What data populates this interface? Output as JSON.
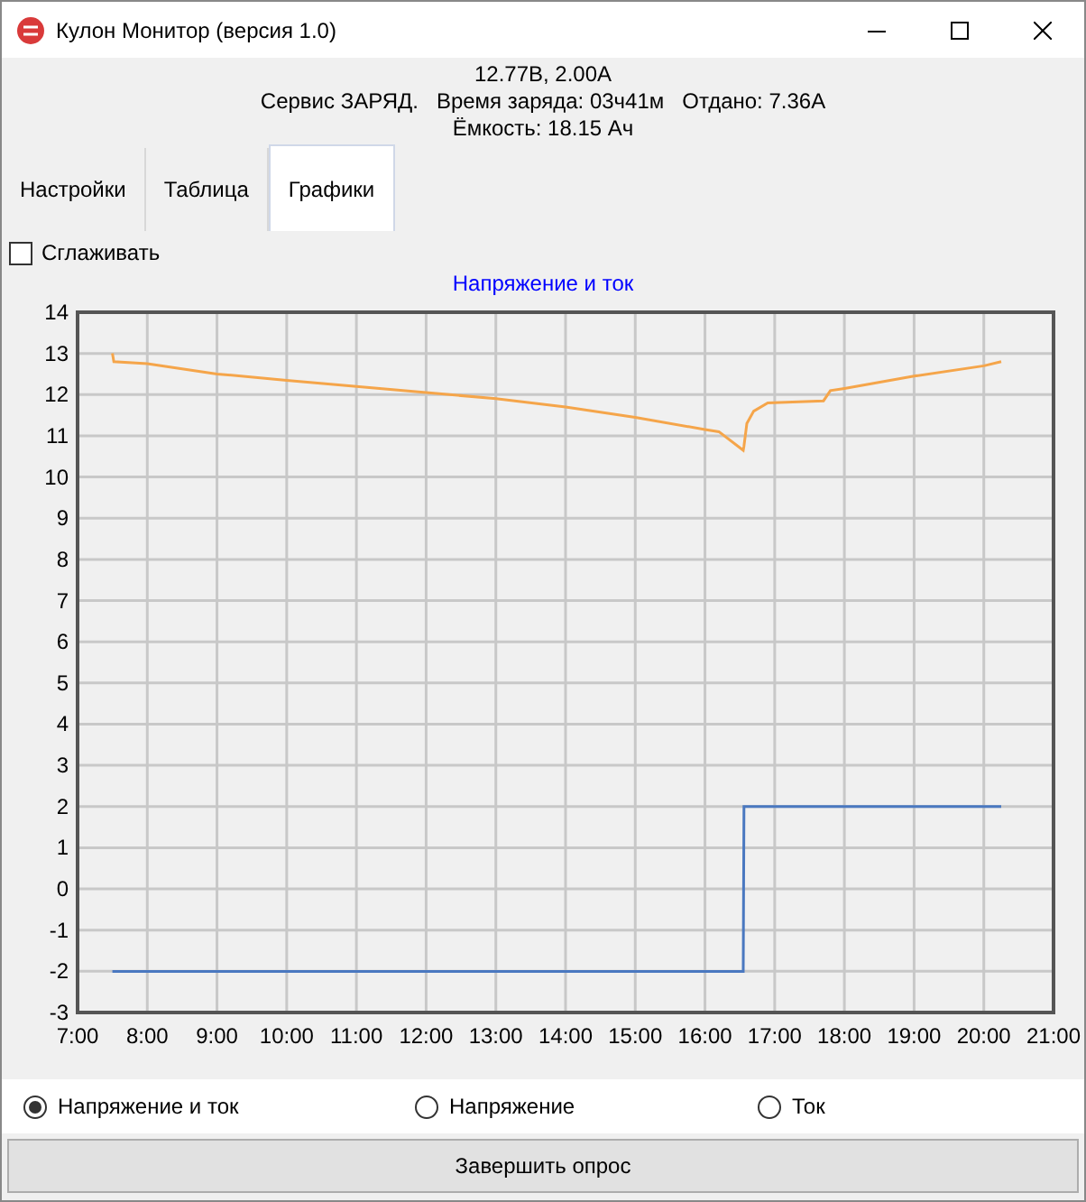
{
  "window": {
    "title": "Кулон Монитор (версия 1.0)"
  },
  "status": {
    "lines": [
      [
        "12.77В, 2.00А"
      ],
      [
        "Сервис ЗАРЯД.",
        "Время заряда: 03ч41м",
        "Отдано: 7.36А"
      ],
      [
        "Ёмкость: 18.15 Ач"
      ]
    ]
  },
  "tabs": [
    {
      "label": "Настройки",
      "selected": false
    },
    {
      "label": "Таблица",
      "selected": false
    },
    {
      "label": "Графики",
      "selected": true
    }
  ],
  "smoothing": {
    "label": "Сглаживать",
    "checked": false
  },
  "chart": {
    "chart_data": {
      "type": "line",
      "title": "Напряжение и ток",
      "x": [
        7.5,
        7.52,
        8,
        9,
        10,
        11,
        12,
        13,
        14,
        15,
        16,
        16.2,
        16.55,
        16.56,
        16.6,
        16.7,
        16.9,
        17.7,
        17.8,
        18,
        19,
        20,
        20.25
      ],
      "series": [
        {
          "color": "#f5a54a",
          "values": [
            13.0,
            12.8,
            12.75,
            12.5,
            12.35,
            12.2,
            12.05,
            11.9,
            11.7,
            11.45,
            11.15,
            11.1,
            10.65,
            10.75,
            11.3,
            11.6,
            11.8,
            11.85,
            12.1,
            12.15,
            12.45,
            12.7,
            12.8
          ]
        },
        {
          "color": "#4a78c0",
          "values": [
            -2,
            -2,
            -2,
            -2,
            -2,
            -2,
            -2,
            -2,
            -2,
            -2,
            -2,
            -2,
            -2,
            2,
            2,
            2,
            2,
            2,
            2,
            2,
            2,
            2,
            2
          ]
        }
      ],
      "grid": true,
      "xlim": [
        7,
        21
      ],
      "ylim": [
        -3,
        14
      ],
      "xticks": [
        {
          "value": 7,
          "label": "7:00"
        },
        {
          "value": 8,
          "label": "8:00"
        },
        {
          "value": 9,
          "label": "9:00"
        },
        {
          "value": 10,
          "label": "10:00"
        },
        {
          "value": 11,
          "label": "11:00"
        },
        {
          "value": 12,
          "label": "12:00"
        },
        {
          "value": 13,
          "label": "13:00"
        },
        {
          "value": 14,
          "label": "14:00"
        },
        {
          "value": 15,
          "label": "15:00"
        },
        {
          "value": 16,
          "label": "16:00"
        },
        {
          "value": 17,
          "label": "17:00"
        },
        {
          "value": 18,
          "label": "18:00"
        },
        {
          "value": 19,
          "label": "19:00"
        },
        {
          "value": 20,
          "label": "20:00"
        },
        {
          "value": 21,
          "label": "21:00"
        }
      ],
      "yticks": [
        -3,
        -2,
        -1,
        0,
        1,
        2,
        3,
        4,
        5,
        6,
        7,
        8,
        9,
        10,
        11,
        12,
        13,
        14
      ]
    }
  },
  "modes": [
    {
      "label": "Напряжение и ток",
      "selected": true
    },
    {
      "label": "Напряжение",
      "selected": false
    },
    {
      "label": "Ток",
      "selected": false
    }
  ],
  "button": {
    "label": "Завершить опрос"
  }
}
